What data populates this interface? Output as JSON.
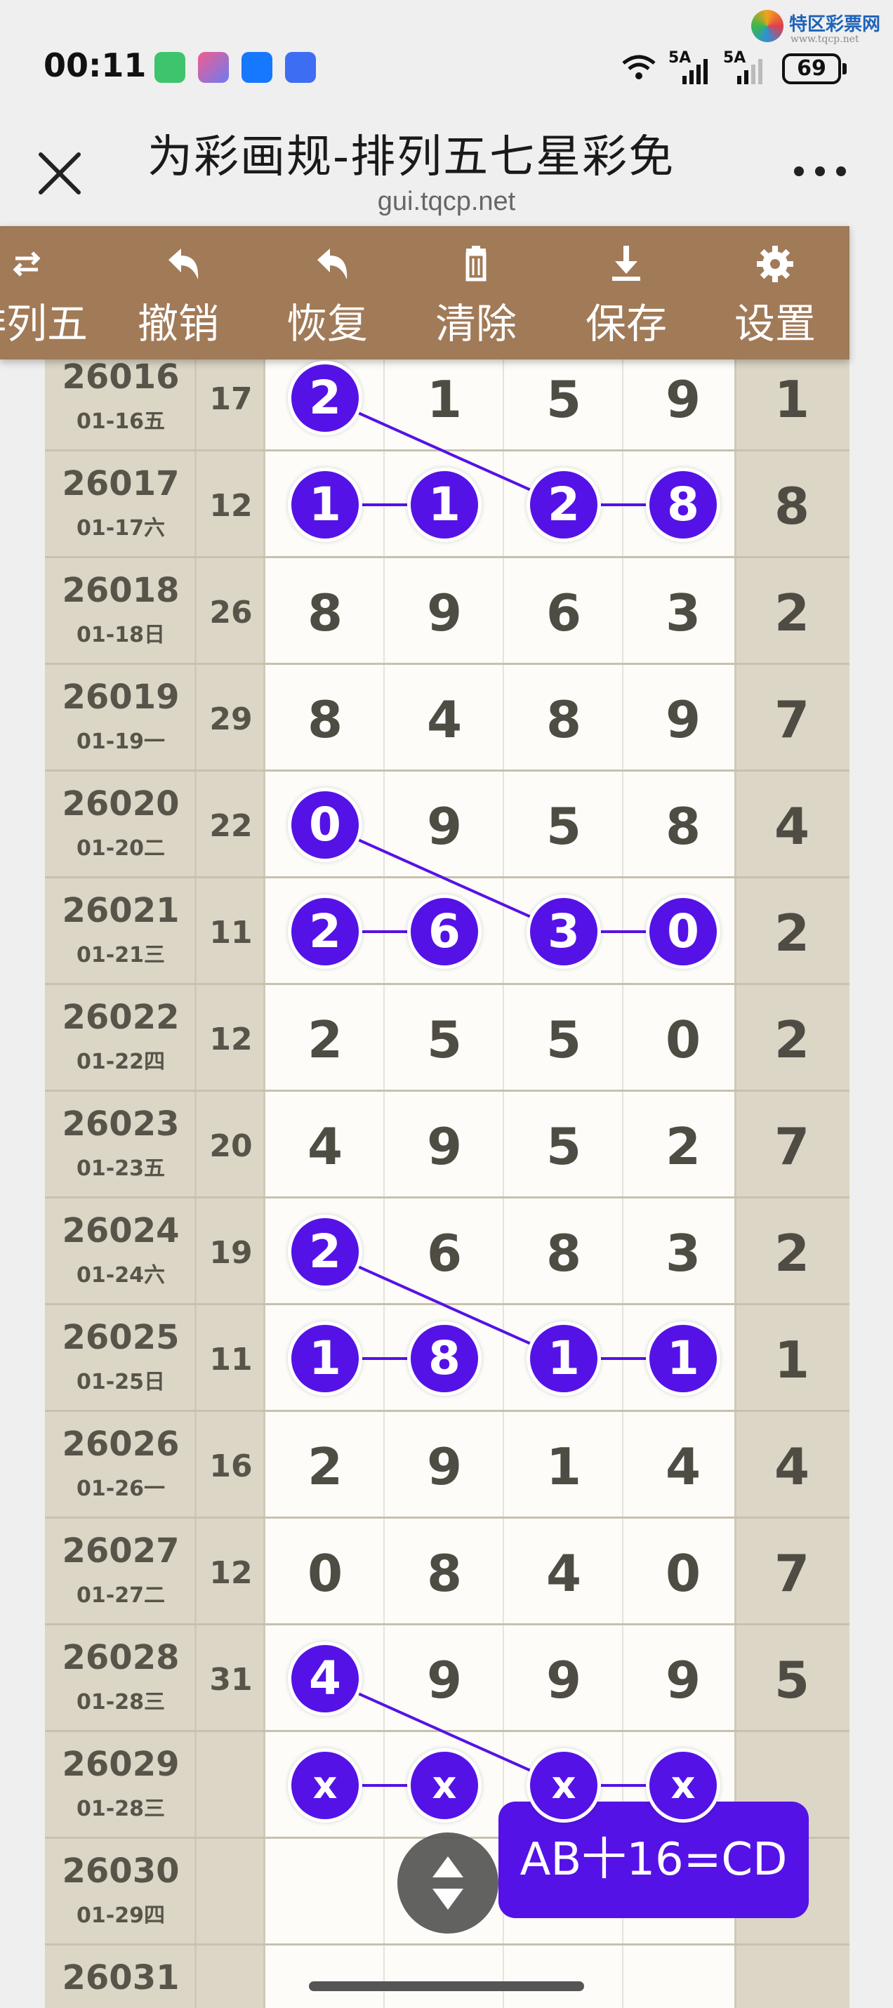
{
  "status_bar": {
    "time": "00:11",
    "signal1": "5A",
    "signal2": "5A",
    "battery": "69"
  },
  "watermark": {
    "name": "特区彩票网",
    "url": "www.tqcp.net"
  },
  "browser": {
    "title": "为彩画规-排列五七星彩免",
    "url": "gui.tqcp.net"
  },
  "toolbar": {
    "items": [
      {
        "label": "排列五",
        "icon": "swap-icon"
      },
      {
        "label": "撤销",
        "icon": "undo-icon"
      },
      {
        "label": "恢复",
        "icon": "redo-icon"
      },
      {
        "label": "清除",
        "icon": "trash-icon"
      },
      {
        "label": "保存",
        "icon": "download-icon"
      },
      {
        "label": "设置",
        "icon": "gear-icon"
      }
    ]
  },
  "colors": {
    "ball": "#5512e6",
    "toolbar": "#a17a58",
    "side": "#dcd6c6"
  },
  "rows": [
    {
      "issue": "26016",
      "date": "01-16五",
      "sum": "17",
      "digits": [
        "2",
        "1",
        "5",
        "9"
      ],
      "tail": "1",
      "marked": [
        true,
        false,
        false,
        false
      ]
    },
    {
      "issue": "26017",
      "date": "01-17六",
      "sum": "12",
      "digits": [
        "1",
        "1",
        "2",
        "8"
      ],
      "tail": "8",
      "marked": [
        true,
        true,
        true,
        true
      ]
    },
    {
      "issue": "26018",
      "date": "01-18日",
      "sum": "26",
      "digits": [
        "8",
        "9",
        "6",
        "3"
      ],
      "tail": "2",
      "marked": [
        false,
        false,
        false,
        false
      ]
    },
    {
      "issue": "26019",
      "date": "01-19一",
      "sum": "29",
      "digits": [
        "8",
        "4",
        "8",
        "9"
      ],
      "tail": "7",
      "marked": [
        false,
        false,
        false,
        false
      ]
    },
    {
      "issue": "26020",
      "date": "01-20二",
      "sum": "22",
      "digits": [
        "0",
        "9",
        "5",
        "8"
      ],
      "tail": "4",
      "marked": [
        true,
        false,
        false,
        false
      ]
    },
    {
      "issue": "26021",
      "date": "01-21三",
      "sum": "11",
      "digits": [
        "2",
        "6",
        "3",
        "0"
      ],
      "tail": "2",
      "marked": [
        true,
        true,
        true,
        true
      ]
    },
    {
      "issue": "26022",
      "date": "01-22四",
      "sum": "12",
      "digits": [
        "2",
        "5",
        "5",
        "0"
      ],
      "tail": "2",
      "marked": [
        false,
        false,
        false,
        false
      ]
    },
    {
      "issue": "26023",
      "date": "01-23五",
      "sum": "20",
      "digits": [
        "4",
        "9",
        "5",
        "2"
      ],
      "tail": "7",
      "marked": [
        false,
        false,
        false,
        false
      ]
    },
    {
      "issue": "26024",
      "date": "01-24六",
      "sum": "19",
      "digits": [
        "2",
        "6",
        "8",
        "3"
      ],
      "tail": "2",
      "marked": [
        true,
        false,
        false,
        false
      ]
    },
    {
      "issue": "26025",
      "date": "01-25日",
      "sum": "11",
      "digits": [
        "1",
        "8",
        "1",
        "1"
      ],
      "tail": "1",
      "marked": [
        true,
        true,
        true,
        true
      ]
    },
    {
      "issue": "26026",
      "date": "01-26一",
      "sum": "16",
      "digits": [
        "2",
        "9",
        "1",
        "4"
      ],
      "tail": "4",
      "marked": [
        false,
        false,
        false,
        false
      ]
    },
    {
      "issue": "26027",
      "date": "01-27二",
      "sum": "12",
      "digits": [
        "0",
        "8",
        "4",
        "0"
      ],
      "tail": "7",
      "marked": [
        false,
        false,
        false,
        false
      ]
    },
    {
      "issue": "26028",
      "date": "01-28三",
      "sum": "31",
      "digits": [
        "4",
        "9",
        "9",
        "9"
      ],
      "tail": "5",
      "marked": [
        true,
        false,
        false,
        false
      ]
    },
    {
      "issue": "26029",
      "date": "01-28三",
      "sum": "",
      "digits": [
        "x",
        "x",
        "x",
        "x"
      ],
      "tail": "",
      "marked": [
        true,
        true,
        true,
        true
      ]
    },
    {
      "issue": "26030",
      "date": "01-29四",
      "sum": "",
      "digits": [
        "",
        "",
        "",
        ""
      ],
      "tail": "",
      "marked": [
        false,
        false,
        false,
        false
      ]
    },
    {
      "issue": "26031",
      "date": "",
      "sum": "",
      "digits": [
        "",
        "",
        "",
        ""
      ],
      "tail": "",
      "marked": [
        false,
        false,
        false,
        false
      ]
    }
  ],
  "links": [
    {
      "from": [
        0,
        0
      ],
      "to": [
        1,
        2
      ]
    },
    {
      "from": [
        1,
        0
      ],
      "to": [
        1,
        1
      ]
    },
    {
      "from": [
        1,
        2
      ],
      "to": [
        1,
        3
      ]
    },
    {
      "from": [
        4,
        0
      ],
      "to": [
        5,
        2
      ]
    },
    {
      "from": [
        5,
        0
      ],
      "to": [
        5,
        1
      ]
    },
    {
      "from": [
        5,
        2
      ],
      "to": [
        5,
        3
      ]
    },
    {
      "from": [
        8,
        0
      ],
      "to": [
        9,
        2
      ]
    },
    {
      "from": [
        9,
        0
      ],
      "to": [
        9,
        1
      ]
    },
    {
      "from": [
        9,
        2
      ],
      "to": [
        9,
        3
      ]
    },
    {
      "from": [
        12,
        0
      ],
      "to": [
        13,
        2
      ]
    },
    {
      "from": [
        13,
        0
      ],
      "to": [
        13,
        1
      ]
    },
    {
      "from": [
        13,
        2
      ],
      "to": [
        13,
        3
      ]
    }
  ],
  "formula_button": "AB十16=CD"
}
